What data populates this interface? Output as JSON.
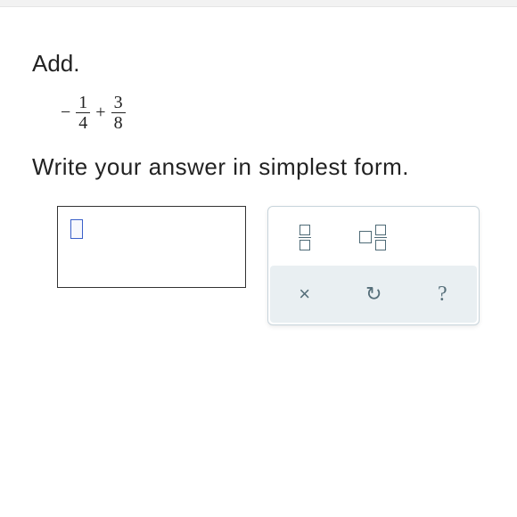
{
  "prompt": "Add.",
  "expression": {
    "leading_sign": "−",
    "term1": {
      "numerator": "1",
      "denominator": "4"
    },
    "operator": "+",
    "term2": {
      "numerator": "3",
      "denominator": "8"
    }
  },
  "instruction": "Write your answer in simplest form.",
  "answer_value": "",
  "tools": {
    "fraction_tool": "fraction",
    "mixed_tool": "mixed-number"
  },
  "controls": {
    "clear": "×",
    "undo": "↺",
    "help": "?"
  }
}
